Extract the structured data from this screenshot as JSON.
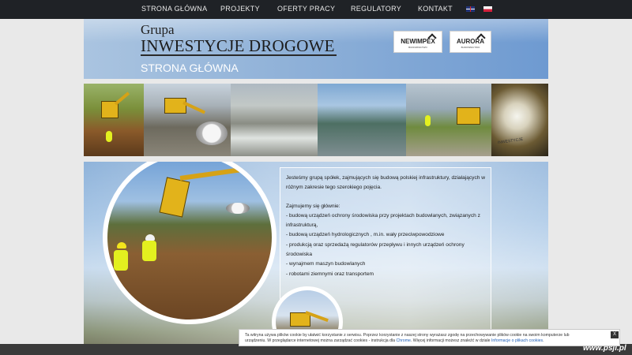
{
  "nav": {
    "items": [
      "STRONA GŁÓWNA",
      "PROJEKTY",
      "OFERTY PRACY",
      "REGULATORY",
      "KONTAKT"
    ]
  },
  "header": {
    "grupa": "Grupa",
    "brand": "INWESTYCJE DROGOWE",
    "page_title": "STRONA GŁÓWNA",
    "logos": {
      "newimpex": "NEWIMPEX",
      "newimpex_sub": "BUDOWNICTWO",
      "aurora": "AURORA",
      "aurora_sub": "BUDOWNICTWO"
    }
  },
  "gallery": {
    "banner_text": "INWESTYCJE"
  },
  "content": {
    "intro": [
      "Jesteśmy grupą spółek, zajmujących się budową polskiej infrastruktury, działających w",
      "różnym zakresie tego szerokiego pojęcia."
    ],
    "lead": "Zajmujemy się głównie:",
    "items": [
      "- budową urządzeń ochrony środowiska przy projektach budowlanych, związanych z",
      "infrastrukturą,",
      "- budową urządzeń hydrologicznych , m.in. wały przeciwpowodziowe",
      "- produkcją oraz sprzedażą regulatorów przepływu i innych urządzeń ochrony",
      "środowiska",
      "- wynajmem maszyn budowlanych",
      "- robotami ziemnymi oraz transportem"
    ]
  },
  "cookie": {
    "line1": "Ta witryna używa plików cookie by ułatwić korzystanie z serwisu. Poprzez korzystanie z naszej strony wyrażasz zgodę na przechowywanie plików cookie na swoim komputerze lub",
    "line2_pre": "urządzeniu. W przeglądarce internetowej można zarządzać cookies - instrukcja dla ",
    "line2_link1": "Chrome",
    "line2_mid": ". Więcej informacji możesz znaleźć w dziale ",
    "line2_link2": "Informacje o plikach cookies",
    "line2_end": ".",
    "close": "X"
  },
  "watermark": "www.psji.pl"
}
